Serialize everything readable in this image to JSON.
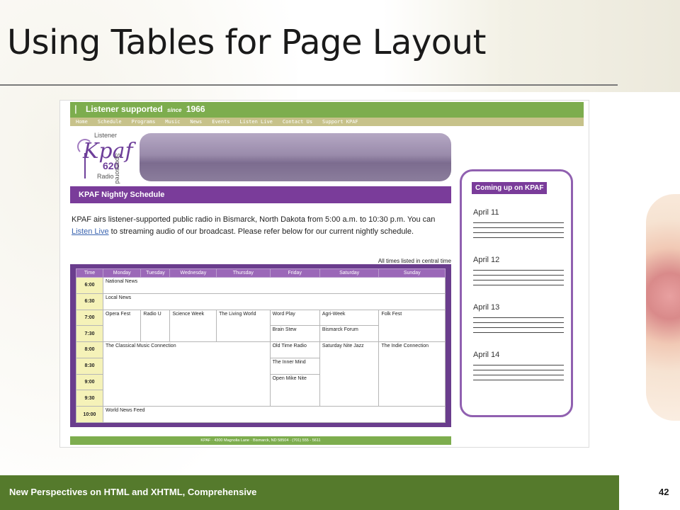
{
  "slide": {
    "title": "Using Tables for Page Layout",
    "footer_caption": "New Perspectives on HTML and XHTML, Comprehensive",
    "page_number": "42"
  },
  "site": {
    "header": {
      "pipe": "|",
      "tagline_pre": "Listener supported",
      "since": "since",
      "year": "1966"
    },
    "nav": [
      "Home",
      "Schedule",
      "Programs",
      "Music",
      "News",
      "Events",
      "Listen Live",
      "Contact Us",
      "Support KPAF"
    ],
    "logo": {
      "listener": "Listener",
      "name": "Kpaf",
      "frequency": "620",
      "radio": "Radio",
      "sponsored": "Sponsored"
    },
    "schedule_heading": "KPAF Nightly Schedule",
    "intro_before_link": "KPAF airs listener-supported public radio in Bismarck, North Dakota from 5:00 a.m. to 10:30 p.m. You can ",
    "intro_link": "Listen Live",
    "intro_after_link": " to streaming audio of our broadcast. Please refer below for our current nightly schedule.",
    "time_zone_note": "All times listed in central time",
    "table": {
      "headers": [
        "Time",
        "Monday",
        "Tuesday",
        "Wednesday",
        "Thursday",
        "Friday",
        "Saturday",
        "Sunday"
      ],
      "times": [
        "6:00",
        "6:30",
        "7:00",
        "7:30",
        "8:00",
        "8:30",
        "9:00",
        "9:30",
        "10:00"
      ],
      "programs": {
        "national_news": "National News",
        "local_news": "Local News",
        "opera_fest": "Opera Fest",
        "radio_u": "Radio U",
        "science_week": "Science Week",
        "living_world": "The Living World",
        "word_play": "Word Play",
        "agri_week": "Agri-Week",
        "folk_fest": "Folk Fest",
        "brain_stew": "Brain Stew",
        "bismarck_forum": "Bismarck Forum",
        "classical": "The Classical Music Connection",
        "old_time_radio": "Old Time Radio",
        "saturday_jazz": "Saturday Nite Jazz",
        "indie_connection": "The Indie Connection",
        "inner_mind": "The Inner Mind",
        "open_mike": "Open Mike Nite",
        "world_news_feed": "World News Feed"
      }
    },
    "footer_address": "KPAF · 4300 Magnolia Lane · Bismarck, ND 58504 · (701) 555 - 5611",
    "sidebar": {
      "heading": "Coming up on KPAF",
      "days": [
        "April 11",
        "April 12",
        "April 13",
        "April 14"
      ]
    }
  },
  "colors": {
    "site_green": "#7dad4e",
    "site_purple": "#7a3c9a",
    "slide_bar": "#557a2c",
    "time_cell": "#f5f2b8"
  }
}
